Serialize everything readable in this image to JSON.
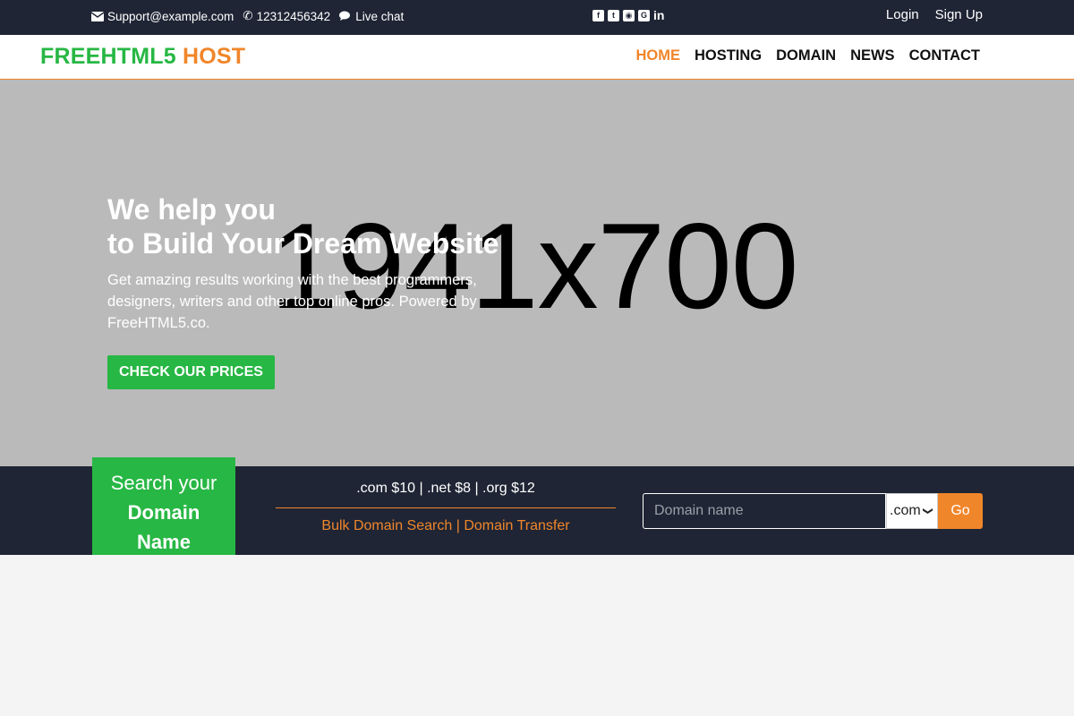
{
  "topbar": {
    "email": "Support@example.com",
    "phone": "12312456342",
    "chat": "Live chat",
    "social_icons": [
      "facebook-icon",
      "twitter-icon",
      "instagram-icon",
      "google-plus-icon",
      "linkedin-icon"
    ],
    "login": "Login",
    "signup": "Sign Up"
  },
  "navbar": {
    "brand_part1": "FREEHTML5",
    "brand_part2": "HOST",
    "links": [
      "HOME",
      "HOSTING",
      "DOMAIN",
      "NEWS",
      "CONTACT"
    ],
    "active": "HOME"
  },
  "hero": {
    "placeholder_text": "1941x700",
    "title_line1": "We help you",
    "title_line2": "to Build Your Dream Website",
    "description": "Get amazing results working with the best programmers, designers, writers and other top online pros. Powered by FreeHTML5.co.",
    "cta": "CHECK OUR PRICES"
  },
  "domain_search": {
    "title_line1": "Search your",
    "title_line2": "Domain",
    "title_line3": "Name",
    "prices": ".com $10 | .net $8 | .org $12",
    "link_bulk": "Bulk Domain Search",
    "link_separator": "|",
    "link_transfer": "Domain Transfer",
    "input_placeholder": "Domain name",
    "tld_selected": ".com",
    "go_button": "Go"
  },
  "colors": {
    "dark": "#1f2535",
    "green": "#27b744",
    "orange": "#f0862a",
    "hero_gray": "#bababa"
  }
}
